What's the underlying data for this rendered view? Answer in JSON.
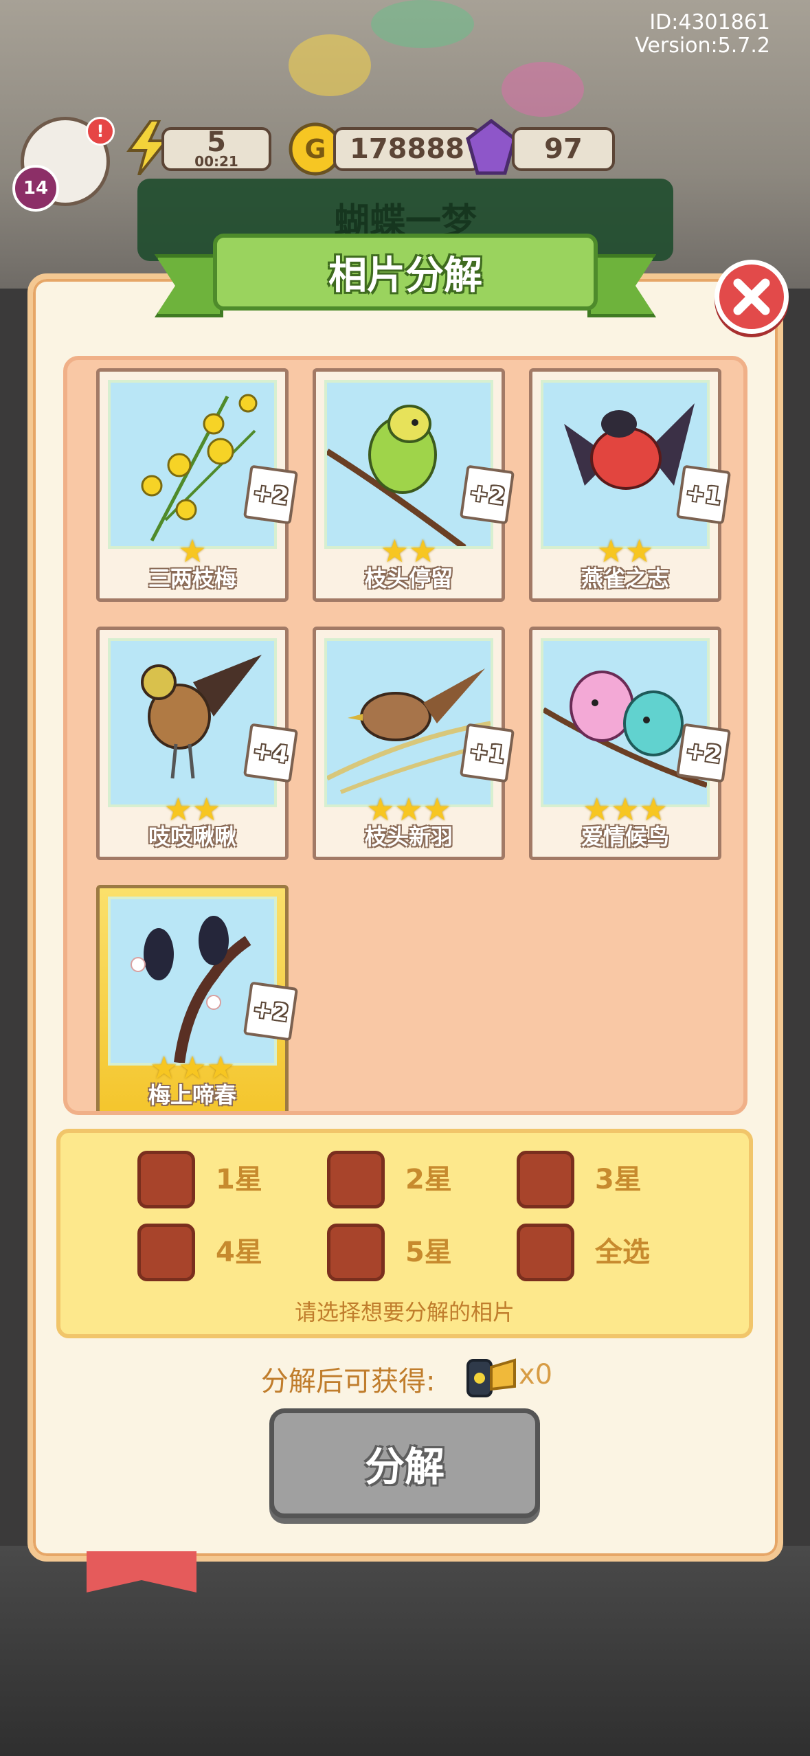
{
  "hud": {
    "user_id": "ID:4301861",
    "version": "Version:5.7.2",
    "level": "14",
    "energy": "5",
    "energy_timer": "00:21",
    "coins": "178888",
    "gems": "97",
    "background_title": "蝴蝶一梦"
  },
  "dialog": {
    "title": "相片分解"
  },
  "cards": [
    {
      "name": "三两枝梅",
      "stars": 1,
      "count": "+2",
      "icon": "jasmine-flower"
    },
    {
      "name": "枝头停留",
      "stars": 2,
      "count": "+2",
      "icon": "green-parakeet"
    },
    {
      "name": "燕雀之志",
      "stars": 2,
      "count": "+1",
      "icon": "red-bullfinch"
    },
    {
      "name": "吱吱啾啾",
      "stars": 2,
      "count": "+4",
      "icon": "brown-bird"
    },
    {
      "name": "枝头新羽",
      "stars": 3,
      "count": "+1",
      "icon": "sparrow-on-branch"
    },
    {
      "name": "爱情候鸟",
      "stars": 3,
      "count": "+2",
      "icon": "lovebirds"
    },
    {
      "name": "梅上啼春",
      "stars": 3,
      "count": "+2",
      "icon": "magpies-on-plum"
    }
  ],
  "filters": {
    "options": [
      "1星",
      "2星",
      "3星",
      "4星",
      "5星",
      "全选"
    ],
    "hint": "请选择想要分解的相片"
  },
  "reward": {
    "label": "分解后可获得:",
    "count": "x0",
    "icon": "film-roll-icon"
  },
  "actions": {
    "decompose": "分解"
  },
  "colors": {
    "title_green": "#9ad35e",
    "close_red": "#e24a4a",
    "checkbox_brown": "#a8442b",
    "star_yellow": "#f7c621",
    "button_gray": "#a0a0a0"
  }
}
